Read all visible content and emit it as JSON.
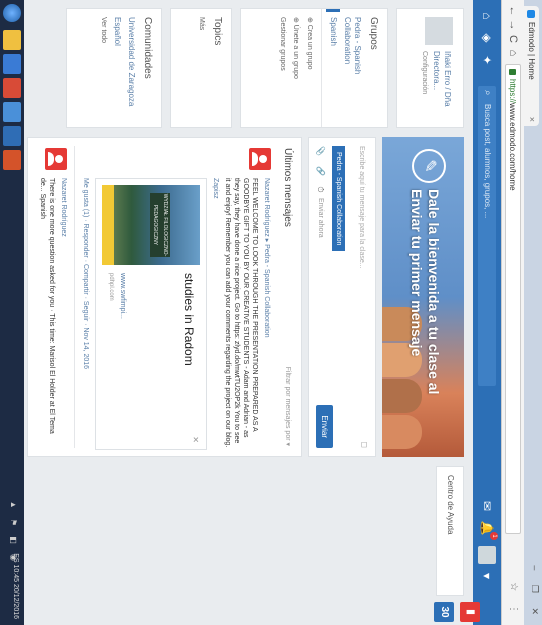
{
  "browser": {
    "tab_title": "Edmodo | Home",
    "tab_close": "×",
    "window_buttons": "– ❐ ✕",
    "nav_back": "←",
    "nav_forward": "→",
    "nav_reload": "C",
    "nav_home": "⌂",
    "url_prefix": "https://",
    "url_rest": "www.edmodo.com/home",
    "extras": "☆ ⋮"
  },
  "topnav": {
    "search_placeholder": "Busca post, alumnos, grupos, ...",
    "notification_count": "1"
  },
  "sidebar": {
    "profile_name": "Iñaki Erro / Dña Directora...",
    "profile_sub": "Configuración",
    "groups_title": "Grupos",
    "groups": [
      "Pedra - Spanish Collaboration",
      "Spanish"
    ],
    "create_group": "⊕ Crea un grupo",
    "join_group": "⊕ Únete a un grupo",
    "manage_groups": "Gestionar grupos",
    "topics_title": "Topics",
    "topics_more": "Más",
    "communities_title": "Comunidades",
    "communities": [
      "Universidad de Zaragoza",
      "Español"
    ],
    "communities_more": "Ver todo"
  },
  "banner": {
    "title_line1": "Dale la bienvenida a tu clase al",
    "title_line2": "Enviar tu primer mensaje"
  },
  "post": {
    "placeholder": "Escribe aquí tu mensaje para la clase...",
    "chip": "Pedra - Spanish Collaboration",
    "tools": "📎 🔗 ⏱",
    "schedule": "Enviar ahora",
    "send": "Enviar",
    "expand": "◻"
  },
  "latest": {
    "title": "Últimos mensajes",
    "filter": "Filtrar por mensajes por ▾",
    "author1": "Nazaret Rodríguez ▸ Pedra - Spanish Collaboration",
    "body1": "FEEL WELCOME TO LOOK THROUGH THE PRESENTATION PREPARED AS A GOODBYE GIFT TO YOU BY OUR CREATIVE STUDENTS - Adam and Adrian - as they say, they have done a nice project. Go to https: zlyd.do/mwtTU2OP2k You to see it and enjoy! Remember you can add your comments regarding the project on our blog.",
    "link1": "Zapisz",
    "preview_title": "studies in Radom",
    "preview_caption": "www.swfimpi...",
    "preview_by": "pdhpl.com",
    "preview_close": "✕",
    "sign_text": "WYDZIAŁ FILOLOGICZNO-PEDAGOGICZNY",
    "actions1": "Me gusta (1) · Responder · Compartir · Seguir · Nov 14, 2016",
    "author2": "Nazaret Rodríguez",
    "body2": "There is one more question asked for you · This time: Marisol El Holder at El Tema de... Spanish"
  },
  "right": {
    "help": "Centro de Ayuda"
  },
  "taskbar": {
    "tray": "ES 10:45 20/12/2016",
    "icons": "▲ ⚑ ◧ ◉"
  },
  "desktop": {
    "icon1": "▮",
    "icon2": "30"
  }
}
